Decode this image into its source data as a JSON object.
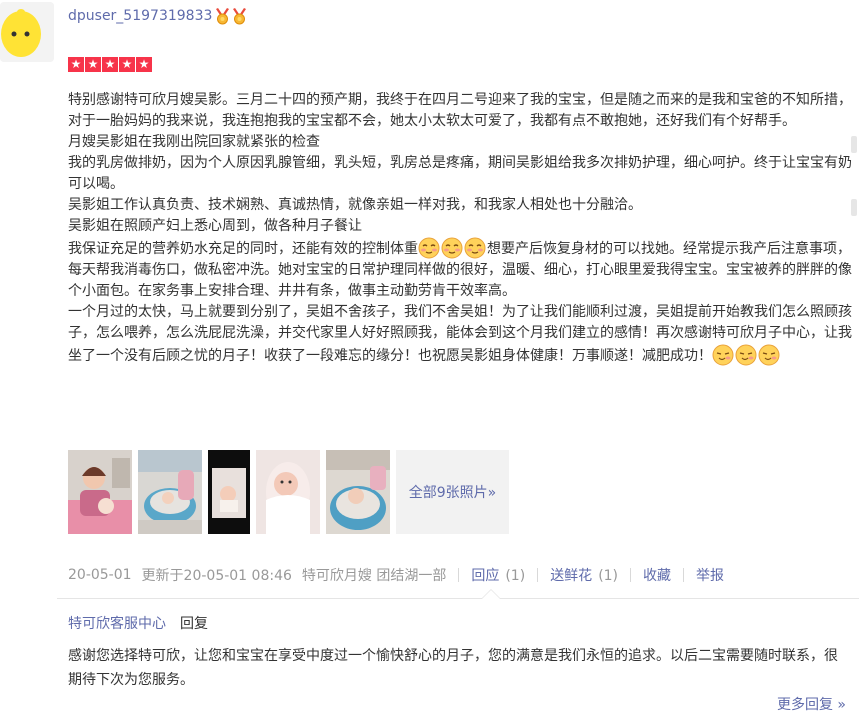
{
  "user": {
    "name": "dpuser_5197319833",
    "medals": [
      "medal-icon",
      "medal-icon"
    ]
  },
  "rating": {
    "stars": 5,
    "max": 5
  },
  "review": {
    "p1": "特别感谢特可欣月嫂吴影。三月二十四的预产期，我终于在四月二号迎来了我的宝宝，但是随之而来的是我和宝爸的不知所措，对于一胎妈妈的我来说，我连抱抱我的宝宝都不会，她太小太软太可爱了，我都有点不敢抱她，还好我们有个好帮手。",
    "p2": "月嫂吴影姐在我刚出院回家就紧张的检查",
    "p3": "我的乳房做排奶，因为个人原因乳腺管细，乳头短，乳房总是疼痛，期间吴影姐给我多次排奶护理，细心呵护。终于让宝宝有奶可以喝。",
    "p4": "吴影姐工作认真负责、技术娴熟、真诚热情，就像亲姐一样对我，和我家人相处也十分融洽。",
    "p5": "吴影姐在照顾产妇上悉心周到，做各种月子餐让",
    "p6a": "我保证充足的营养奶水充足的同时，还能有效的控制体重",
    "p6b": "想要产后恢复身材的可以找她。经常提示我产后注意事项，每天帮我消毒伤口，做私密冲洗。她对宝宝的日常护理同样做的很好，温暖、细心，打心眼里爱我得宝宝。宝宝被养的胖胖的像个小面包。在家务事上安排合理、井井有条，做事主动勤劳肯干效率高。",
    "p7": "一个月过的太快，马上就要到分别了，吴姐不舍孩子，我们不舍吴姐！为了让我们能顺利过渡，吴姐提前开始教我们怎么照顾孩子，怎么喂养，怎么洗屁屁洗澡，并交代家里人好好照顾我，能体会到这个月我们建立的感情！再次感谢特可欣月子中心，让我坐了一个没有后顾之忧的月子！收获了一段难忘的缘分！也祝愿吴影姐身体健康！万事顺遂！减肥成功！"
  },
  "photos": {
    "thumbnails": [
      "photo-1",
      "photo-2",
      "photo-3",
      "photo-4",
      "photo-5"
    ],
    "more_label": "全部9张照片»"
  },
  "meta": {
    "date": "20-05-01",
    "updated": "更新于20-05-01 08:46",
    "shop": "特可欣月嫂 团结湖一部",
    "reply_label": "回应",
    "reply_count": "(1)",
    "flower_label": "送鲜花",
    "flower_count": "(1)",
    "favorite_label": "收藏",
    "report_label": "举报"
  },
  "reply": {
    "author": "特可欣客服中心",
    "tag": "回复",
    "body": "感谢您选择特可欣，让您和宝宝在享受中度过一个愉快舒心的月子，您的满意是我们永恒的追求。以后二宝需要随时联系，很期待下次为您服务。"
  },
  "more_replies": "更多回复 »",
  "colors": {
    "link": "#5f6bab",
    "star": "#f7344a",
    "muted": "#999999"
  }
}
